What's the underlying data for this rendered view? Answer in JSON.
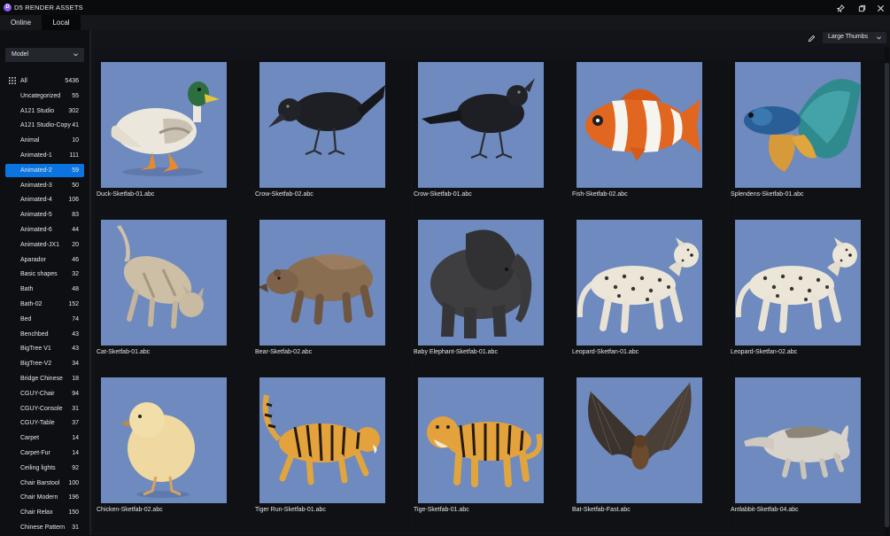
{
  "app": {
    "title": "D5 RENDER ASSETS",
    "logo_letter": "D"
  },
  "tabs": [
    {
      "label": "Online"
    },
    {
      "label": "Local"
    }
  ],
  "active_tab": "Local",
  "filter": {
    "type_select": "Model",
    "view_select": "Large Thumbs"
  },
  "categories": [
    {
      "name": "All",
      "count": "5436"
    },
    {
      "name": "Uncategorized",
      "count": "55"
    },
    {
      "name": "A121 Studio",
      "count": "302"
    },
    {
      "name": "A121 Studio-Copy",
      "count": "41"
    },
    {
      "name": "Animal",
      "count": "10"
    },
    {
      "name": "Animated-1",
      "count": "111"
    },
    {
      "name": "Animated-2",
      "count": "59"
    },
    {
      "name": "Animated-3",
      "count": "50"
    },
    {
      "name": "Animated-4",
      "count": "106"
    },
    {
      "name": "Animated-5",
      "count": "83"
    },
    {
      "name": "Animated-6",
      "count": "44"
    },
    {
      "name": "Animated-JX1",
      "count": "20"
    },
    {
      "name": "Aparador",
      "count": "46"
    },
    {
      "name": "Basic shapes",
      "count": "32"
    },
    {
      "name": "Bath",
      "count": "48"
    },
    {
      "name": "Bath-02",
      "count": "152"
    },
    {
      "name": "Bed",
      "count": "74"
    },
    {
      "name": "Benchbed",
      "count": "43"
    },
    {
      "name": "BigTree V1",
      "count": "43"
    },
    {
      "name": "BigTree-V2",
      "count": "34"
    },
    {
      "name": "Bridge Chinese",
      "count": "18"
    },
    {
      "name": "CGUY-Chair",
      "count": "94"
    },
    {
      "name": "CGUY-Console",
      "count": "31"
    },
    {
      "name": "CGUY-Table",
      "count": "37"
    },
    {
      "name": "Carpet",
      "count": "14"
    },
    {
      "name": "Carpet-Fur",
      "count": "14"
    },
    {
      "name": "Ceiling lights",
      "count": "92"
    },
    {
      "name": "Chair Barstool",
      "count": "100"
    },
    {
      "name": "Chair Modern",
      "count": "196"
    },
    {
      "name": "Chair Relax",
      "count": "150"
    },
    {
      "name": "Chinese Pattern",
      "count": "31"
    }
  ],
  "active_category": "Animated-2",
  "assets": [
    {
      "name": "Duck-Sketfab-01.abc",
      "thumb": "duck"
    },
    {
      "name": "Crow-Sketfab-02.abc",
      "thumb": "crow"
    },
    {
      "name": "Crow-Sketfab-01.abc",
      "thumb": "crow2"
    },
    {
      "name": "Fish-Sketfab-02.abc",
      "thumb": "clownfish"
    },
    {
      "name": "Splendens-Sketfab-01.abc",
      "thumb": "betta"
    },
    {
      "name": "Cat-Sketfab-01.abc",
      "thumb": "cat"
    },
    {
      "name": "Bear-Sketfab-02.abc",
      "thumb": "bear"
    },
    {
      "name": "Baby Elephant-Sketfab-01.abc",
      "thumb": "elephant"
    },
    {
      "name": "Leopard-Sketfan-01.abc",
      "thumb": "leopard"
    },
    {
      "name": "Leopard-Sketfan-02.abc",
      "thumb": "leopard2"
    },
    {
      "name": "Chicken-Sketfab-02.abc",
      "thumb": "chick"
    },
    {
      "name": "Tiger Run-Sketfab-01.abc",
      "thumb": "tiger"
    },
    {
      "name": "Tige-Sketfab-01.abc",
      "thumb": "tiger2"
    },
    {
      "name": "Bat-Sketfab-Fast.abc",
      "thumb": "bat"
    },
    {
      "name": "Antlabbit-Sketfab-04.abc",
      "thumb": "anteater"
    }
  ],
  "colors": {
    "accent": "#0a74e0",
    "thumb_bg": "#6e8abe",
    "logo": "#8b5cf6"
  }
}
